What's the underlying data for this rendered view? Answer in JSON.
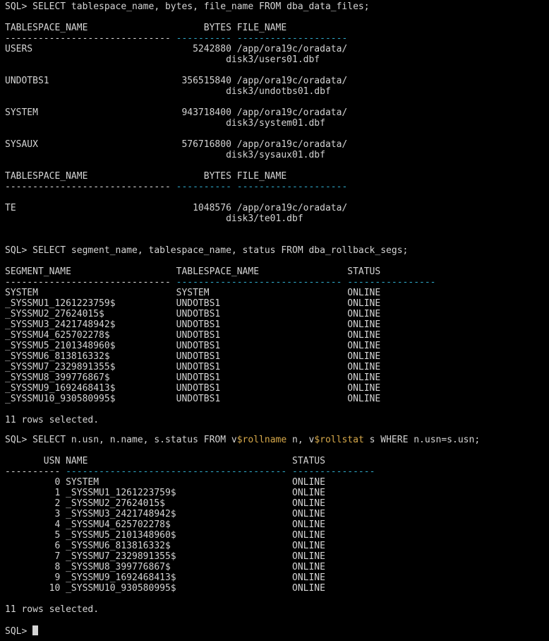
{
  "block1": {
    "query": "SQL> SELECT tablespace_name, bytes, file_name FROM dba_data_files;",
    "header": "TABLESPACE_NAME                     BYTES FILE_NAME",
    "rule_name": "------------------------------",
    "rule_bytes": "----------",
    "rule_file": "--------------------",
    "rows": [
      {
        "line1": "USERS                             5242880 /app/ora19c/oradata/",
        "line2": "                                        disk3/users01.dbf"
      },
      {
        "line1": "UNDOTBS1                        356515840 /app/ora19c/oradata/",
        "line2": "                                        disk3/undotbs01.dbf"
      },
      {
        "line1": "SYSTEM                          943718400 /app/ora19c/oradata/",
        "line2": "                                        disk3/system01.dbf"
      },
      {
        "line1": "SYSAUX                          576716800 /app/ora19c/oradata/",
        "line2": "                                        disk3/sysaux01.dbf"
      }
    ],
    "header2": "TABLESPACE_NAME                     BYTES FILE_NAME",
    "row_te": {
      "line1": "TE                                1048576 /app/ora19c/oradata/",
      "line2": "                                        disk3/te01.dbf"
    }
  },
  "block2": {
    "query": "SQL> SELECT segment_name, tablespace_name, status FROM dba_rollback_segs;",
    "header": "SEGMENT_NAME                   TABLESPACE_NAME                STATUS",
    "rule_seg": "------------------------------",
    "rule_ts": "------------------------------",
    "rule_status": "----------------",
    "rows": [
      "SYSTEM                         SYSTEM                         ONLINE",
      "_SYSSMU1_1261223759$           UNDOTBS1                       ONLINE",
      "_SYSSMU2_27624015$             UNDOTBS1                       ONLINE",
      "_SYSSMU3_2421748942$           UNDOTBS1                       ONLINE",
      "_SYSSMU4_625702278$            UNDOTBS1                       ONLINE",
      "_SYSSMU5_2101348960$           UNDOTBS1                       ONLINE",
      "_SYSSMU6_813816332$            UNDOTBS1                       ONLINE",
      "_SYSSMU7_2329891355$           UNDOTBS1                       ONLINE",
      "_SYSSMU8_399776867$            UNDOTBS1                       ONLINE",
      "_SYSSMU9_1692468413$           UNDOTBS1                       ONLINE",
      "_SYSSMU10_930580995$           UNDOTBS1                       ONLINE"
    ],
    "footer": "11 rows selected."
  },
  "block3": {
    "query_a": "SQL> SELECT n.usn, n.name, s.status FROM v",
    "query_var1": "$rollname",
    "query_b": " n, v",
    "query_var2": "$rollstat",
    "query_c": " s WHERE n.usn=s.usn;",
    "header": "       USN NAME                                     STATUS",
    "rule_usn": "----------",
    "rule_name": "----------------------------------------",
    "rule_status": "---------------",
    "rows": [
      "         0 SYSTEM                                   ONLINE",
      "         1 _SYSSMU1_1261223759$                     ONLINE",
      "         2 _SYSSMU2_27624015$                       ONLINE",
      "         3 _SYSSMU3_2421748942$                     ONLINE",
      "         4 _SYSSMU4_625702278$                      ONLINE",
      "         5 _SYSSMU5_2101348960$                     ONLINE",
      "         6 _SYSSMU6_813816332$                      ONLINE",
      "         7 _SYSSMU7_2329891355$                     ONLINE",
      "         8 _SYSSMU8_399776867$                      ONLINE",
      "         9 _SYSSMU9_1692468413$                     ONLINE",
      "        10 _SYSSMU10_930580995$                     ONLINE"
    ],
    "footer": "11 rows selected."
  },
  "prompt": "SQL> ",
  "colors": {
    "background": "#000000",
    "text": "#d4d4d4",
    "rule_cyan": "#2fa7c7",
    "variable_highlight": "#d7a94a"
  }
}
